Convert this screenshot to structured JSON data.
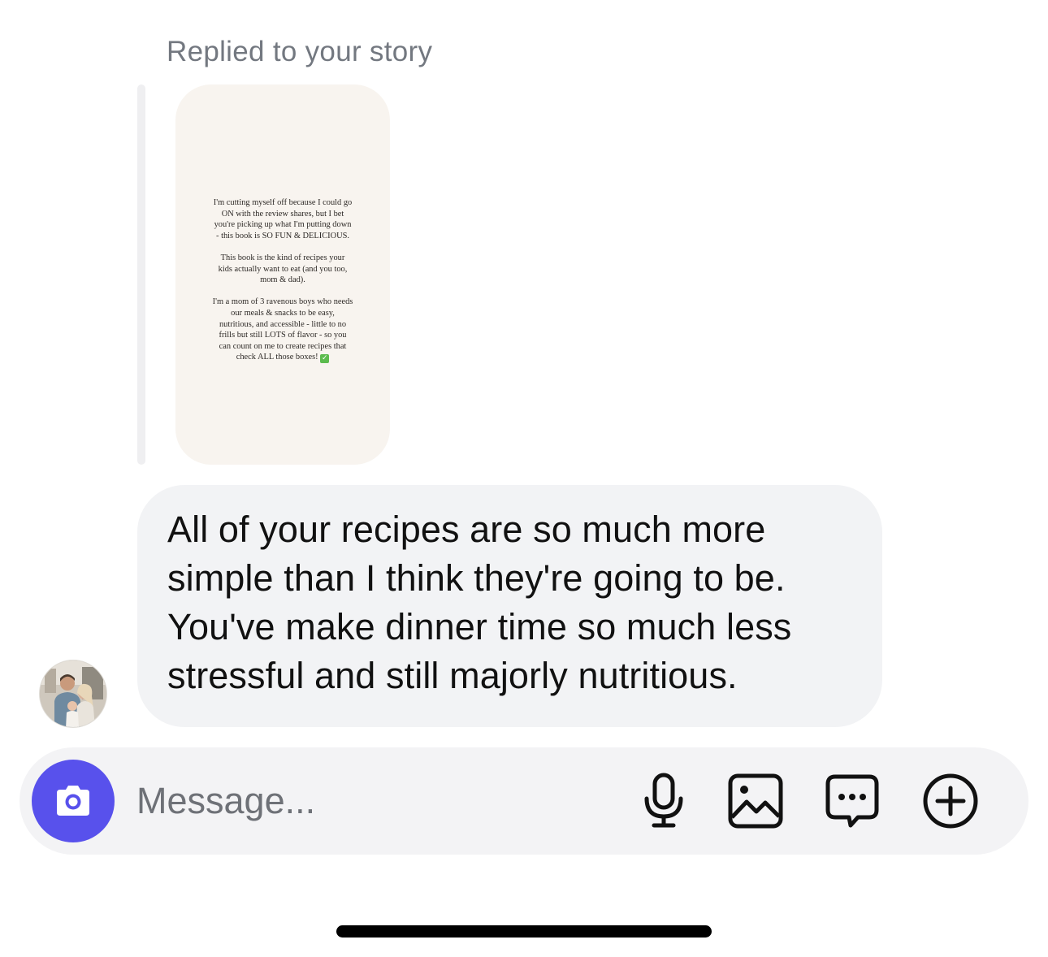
{
  "reply_context": {
    "label": "Replied to your story",
    "story_paragraphs": [
      "I'm cutting myself off because I could go\nON with the review shares, but I bet\nyou're picking up what I'm putting down\n- this book is SO FUN & DELICIOUS.",
      "This book is the kind of recipes your\nkids actually want to eat (and you too,\nmom & dad).",
      "I'm a mom of 3 ravenous boys who needs\nour meals & snacks to be easy,\nnutritious, and accessible - little to no\nfrills but still LOTS of flavor - so you\ncan count on me to create recipes that\ncheck ALL those boxes!"
    ]
  },
  "message": {
    "text": "All of your recipes are so much more\nsimple than I think they're going to be.\nYou've make dinner time so much less\nstressful and still majorly nutritious."
  },
  "composer": {
    "placeholder": "Message...",
    "value": "",
    "icons": {
      "camera": "camera-icon",
      "microphone": "microphone-icon",
      "gallery": "image-icon",
      "sticker": "chat-bubble-dots-icon",
      "add": "plus-circle-icon"
    }
  },
  "colors": {
    "accent": "#5851ec",
    "bubble_background": "#f2f3f5",
    "composer_background": "#f3f3f5",
    "muted_text": "#737880",
    "story_background": "#f8f4ef"
  }
}
